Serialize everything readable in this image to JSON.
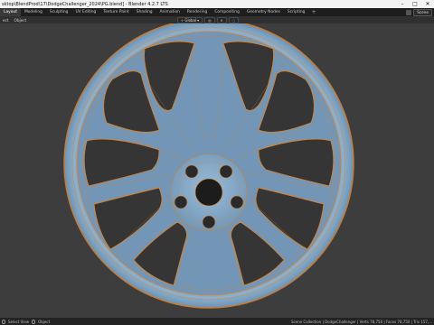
{
  "window": {
    "title": "sktop\\BlendProd\\17\\DodgeChallenger_2024\\PG.blend] - Blender 4.2.7 LTS",
    "minimize_glyph": "–",
    "maximize_glyph": "□",
    "close_glyph": "✕"
  },
  "workspace_tabs": [
    "Layout",
    "Modeling",
    "Sculpting",
    "UV Editing",
    "Texture Paint",
    "Shading",
    "Animation",
    "Rendering",
    "Compositing",
    "Geometry Nodes",
    "Scripting"
  ],
  "active_tab": "Layout",
  "add_tab_label": "+",
  "scene": {
    "label": "Scene"
  },
  "header": {
    "menus": [
      "ect",
      "Object"
    ],
    "transform_label": "Global",
    "pivot_icon": "pivot-icon",
    "snap_icon": "magnet-icon"
  },
  "status": {
    "left_items": [
      "Select View"
    ],
    "object_label": "Object",
    "stats": "Scene Collection | DodgeChallenger | Verts 78,750 | Faces 78,750 | Tris 157,..."
  },
  "colors": {
    "wheel_fill": "#7a9fbe",
    "wire_orange": "#d9822b",
    "viewport_bg": "#3d3d3d"
  }
}
